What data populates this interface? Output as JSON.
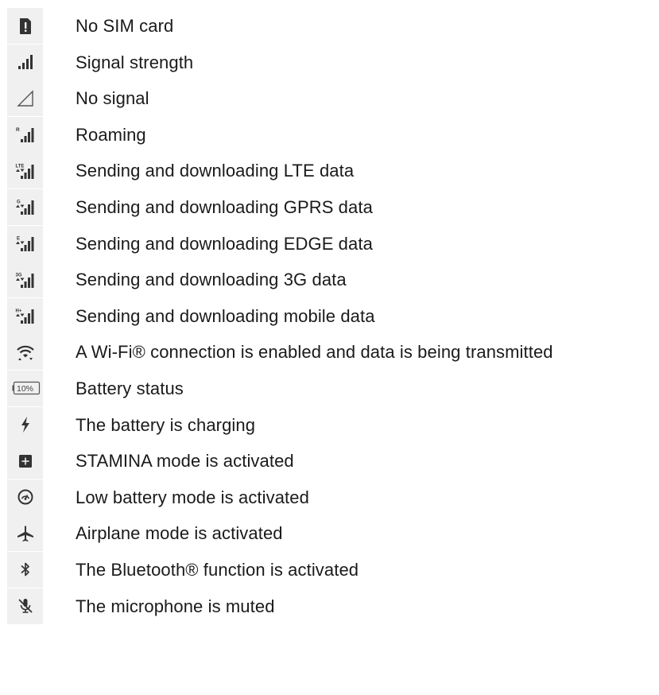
{
  "rows": [
    {
      "icon": "no-sim-card-icon",
      "label": "No SIM card"
    },
    {
      "icon": "signal-strength-icon",
      "label": "Signal strength"
    },
    {
      "icon": "no-signal-icon",
      "label": "No signal"
    },
    {
      "icon": "roaming-icon",
      "label": "Roaming",
      "glyph": "R"
    },
    {
      "icon": "lte-data-icon",
      "label": "Sending and downloading LTE data",
      "glyph": "LTE"
    },
    {
      "icon": "gprs-data-icon",
      "label": "Sending and downloading GPRS data",
      "glyph": "G"
    },
    {
      "icon": "edge-data-icon",
      "label": "Sending and downloading EDGE data",
      "glyph": "E"
    },
    {
      "icon": "3g-data-icon",
      "label": "Sending and downloading 3G data",
      "glyph": "3G"
    },
    {
      "icon": "mobile-data-icon",
      "label": "Sending and downloading mobile data",
      "glyph": "H+"
    },
    {
      "icon": "wifi-transmitting-icon",
      "label": "A Wi-Fi® connection is enabled and data is being transmitted"
    },
    {
      "icon": "battery-status-icon",
      "label": "Battery status",
      "glyph": "10%"
    },
    {
      "icon": "battery-charging-icon",
      "label": "The battery is charging"
    },
    {
      "icon": "stamina-mode-icon",
      "label": "STAMINA mode is activated"
    },
    {
      "icon": "low-battery-mode-icon",
      "label": "Low battery mode is activated"
    },
    {
      "icon": "airplane-mode-icon",
      "label": "Airplane mode is activated"
    },
    {
      "icon": "bluetooth-icon",
      "label": "The Bluetooth® function is activated"
    },
    {
      "icon": "microphone-muted-icon",
      "label": "The microphone is muted"
    }
  ]
}
